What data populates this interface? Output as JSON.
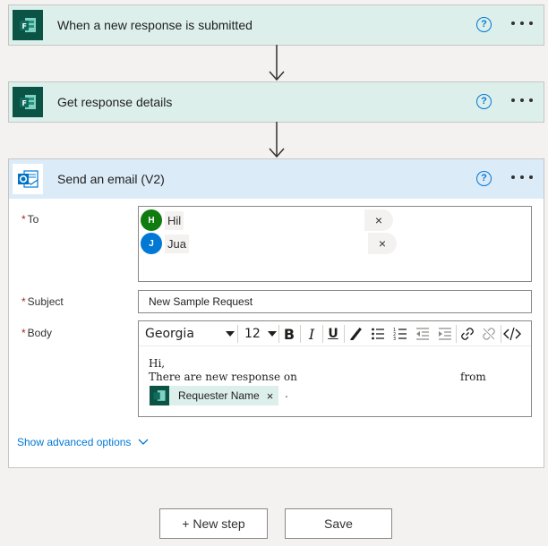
{
  "steps": [
    {
      "title": "When a new response is submitted",
      "icon": "microsoft-forms-icon"
    },
    {
      "title": "Get response details",
      "icon": "microsoft-forms-icon"
    },
    {
      "title": "Send an email (V2)",
      "icon": "outlook-icon"
    }
  ],
  "help_glyph": "?",
  "email": {
    "to_label": "To",
    "subject_label": "Subject",
    "body_label": "Body",
    "required_mark": "*",
    "recipients": [
      {
        "initial": "H",
        "name": "Hil",
        "color": "#107c10"
      },
      {
        "initial": "J",
        "name": "Jua",
        "color": "#0078d4"
      }
    ],
    "remove_glyph": "×",
    "subject": "New Sample Request",
    "toolbar": {
      "font": "Georgia",
      "size": "12",
      "bold": "B",
      "italic": "I",
      "underline": "U"
    },
    "body": {
      "line1": "Hi,",
      "line2": "There are new response on",
      "from": "from",
      "token_label": "Requester Name",
      "trailing": "."
    }
  },
  "advanced_options": "Show advanced options",
  "buttons": {
    "new_step": "+ New step",
    "save": "Save"
  },
  "colors": {
    "forms_dark": "#0b5345",
    "accent": "#0078d4",
    "required": "#a4262c"
  }
}
